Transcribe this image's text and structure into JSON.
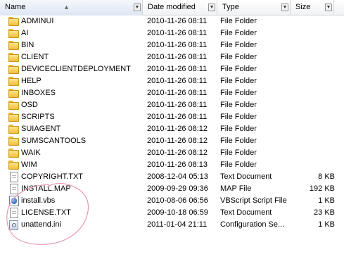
{
  "columns": {
    "name": "Name",
    "date": "Date modified",
    "type": "Type",
    "size": "Size"
  },
  "files": [
    {
      "name": "ADMINUI",
      "date": "2010-11-26 08:11",
      "type": "File Folder",
      "size": "",
      "icon": "folder-icon"
    },
    {
      "name": "AI",
      "date": "2010-11-26 08:11",
      "type": "File Folder",
      "size": "",
      "icon": "folder-icon"
    },
    {
      "name": "BIN",
      "date": "2010-11-26 08:11",
      "type": "File Folder",
      "size": "",
      "icon": "folder-icon"
    },
    {
      "name": "CLIENT",
      "date": "2010-11-26 08:11",
      "type": "File Folder",
      "size": "",
      "icon": "folder-icon"
    },
    {
      "name": "DEVICECLIENTDEPLOYMENT",
      "date": "2010-11-26 08:11",
      "type": "File Folder",
      "size": "",
      "icon": "folder-icon"
    },
    {
      "name": "HELP",
      "date": "2010-11-26 08:11",
      "type": "File Folder",
      "size": "",
      "icon": "folder-icon"
    },
    {
      "name": "INBOXES",
      "date": "2010-11-26 08:11",
      "type": "File Folder",
      "size": "",
      "icon": "folder-icon"
    },
    {
      "name": "OSD",
      "date": "2010-11-26 08:11",
      "type": "File Folder",
      "size": "",
      "icon": "folder-icon"
    },
    {
      "name": "SCRIPTS",
      "date": "2010-11-26 08:11",
      "type": "File Folder",
      "size": "",
      "icon": "folder-icon"
    },
    {
      "name": "SUIAGENT",
      "date": "2010-11-26 08:12",
      "type": "File Folder",
      "size": "",
      "icon": "folder-icon"
    },
    {
      "name": "SUMSCANTOOLS",
      "date": "2010-11-26 08:12",
      "type": "File Folder",
      "size": "",
      "icon": "folder-icon"
    },
    {
      "name": "WAIK",
      "date": "2010-11-26 08:12",
      "type": "File Folder",
      "size": "",
      "icon": "folder-icon"
    },
    {
      "name": "WIM",
      "date": "2010-11-26 08:13",
      "type": "File Folder",
      "size": "",
      "icon": "folder-icon"
    },
    {
      "name": "COPYRIGHT.TXT",
      "date": "2008-12-04 05:13",
      "type": "Text Document",
      "size": "8 KB",
      "icon": "text-document-icon"
    },
    {
      "name": "INSTALL.MAP",
      "date": "2009-09-29 09:36",
      "type": "MAP File",
      "size": "192 KB",
      "icon": "generic-file-icon"
    },
    {
      "name": "install.vbs",
      "date": "2010-08-06 06:56",
      "type": "VBScript Script File",
      "size": "1 KB",
      "icon": "vbscript-file-icon"
    },
    {
      "name": "LICENSE.TXT",
      "date": "2009-10-18 06:59",
      "type": "Text Document",
      "size": "23 KB",
      "icon": "text-document-icon"
    },
    {
      "name": "unattend.ini",
      "date": "2011-01-04 21:11",
      "type": "Configuration Se...",
      "size": "1 KB",
      "icon": "config-file-icon"
    }
  ],
  "annotation_color": "#e89ab4",
  "colors": {
    "folder": "#f1be3c",
    "header_border": "#d5d5d5",
    "sorted_header": "#dde6f3"
  }
}
